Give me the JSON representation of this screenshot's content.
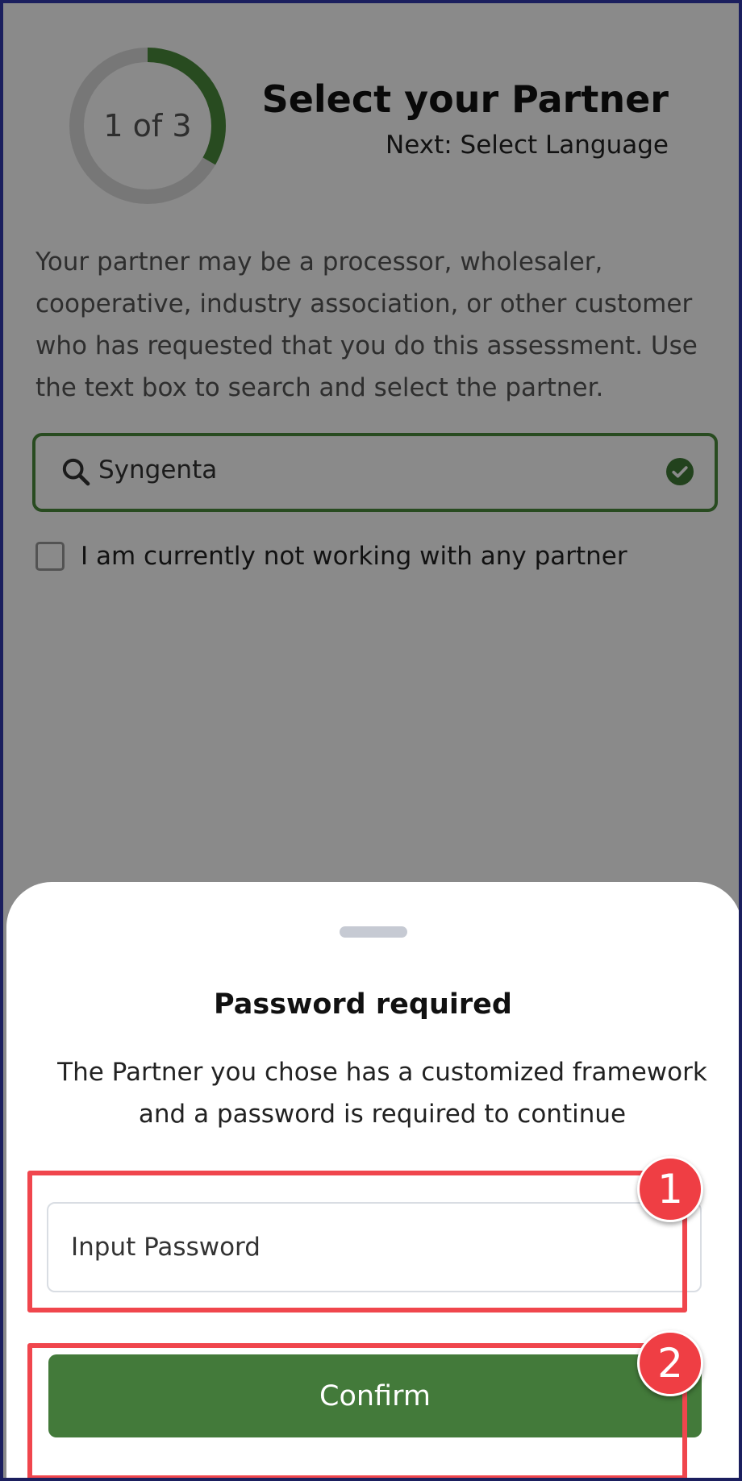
{
  "header": {
    "progress_label": "1 of 3",
    "progress_fraction": 0.333,
    "title": "Select your Partner",
    "next_step": "Next: Select Language"
  },
  "description": "Your partner may be a processor, wholesaler, cooperative, industry association, or other customer who has requested that you do this assessment. Use the text box to search and select the partner.",
  "search": {
    "value": "Syngenta",
    "icon": "search-icon",
    "status_icon": "check-circle-icon"
  },
  "no_partner": {
    "label": "I am currently not working with any partner",
    "checked": false
  },
  "dialog": {
    "title": "Password required",
    "message": "The Partner you chose has a customized framework and a password is required to continue",
    "password_placeholder": "Input Password",
    "confirm_label": "Confirm"
  },
  "callouts": [
    "1",
    "2"
  ],
  "colors": {
    "accent_green": "#437a3a",
    "ring_green": "#4b8b3b",
    "callout_red": "#ef3e44",
    "frame_border": "#1b1f5e"
  }
}
